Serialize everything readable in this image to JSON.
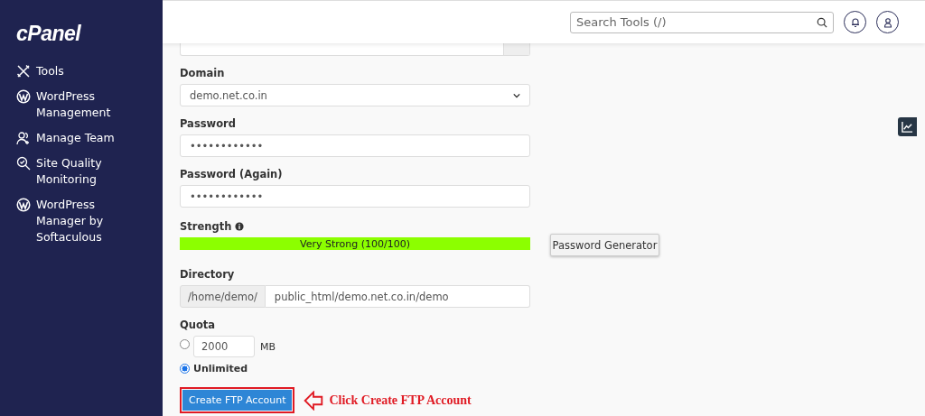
{
  "logo": "cPanel",
  "sidebar": {
    "items": [
      {
        "label": "Tools",
        "kind": "tools"
      },
      {
        "label": "WordPress Management",
        "kind": "wordpress"
      },
      {
        "label": "Manage Team",
        "kind": "team"
      },
      {
        "label": "Site Quality Monitoring",
        "kind": "quality"
      },
      {
        "label": "WordPress Manager by Softaculous",
        "kind": "wordpress"
      }
    ]
  },
  "header": {
    "search": {
      "placeholder": "Search Tools (/)"
    }
  },
  "form": {
    "domain": {
      "label": "Domain",
      "value": "demo.net.co.in"
    },
    "password": {
      "label": "Password",
      "value": "••••••••••••"
    },
    "password_again": {
      "label": "Password (Again)",
      "value": "••••••••••••"
    },
    "strength": {
      "label": "Strength",
      "level": 1,
      "text": "Very Strong (100/100)"
    },
    "generator_button": "Password Generator",
    "directory": {
      "label": "Directory",
      "prefix": "/home/demo/",
      "value": "public_html/demo.net.co.in/demo"
    },
    "quota": {
      "label": "Quota",
      "options": [
        {
          "kind": "limited",
          "selected": false,
          "value": "2000",
          "unit": "MB"
        },
        {
          "kind": "unlimited",
          "selected": true,
          "label": "Unlimited"
        }
      ]
    },
    "submit_button": "Create FTP Account",
    "annotation": "Click Create FTP Account"
  }
}
